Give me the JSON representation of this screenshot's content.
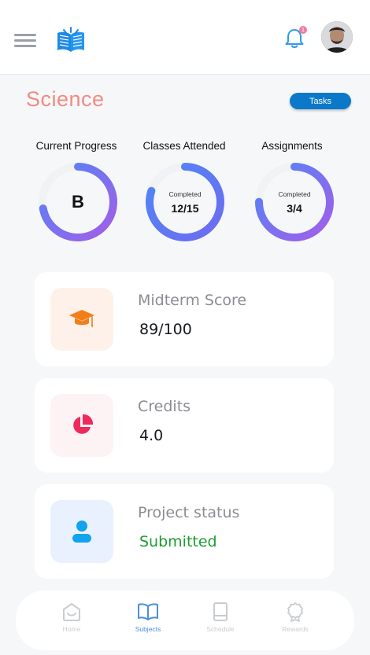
{
  "header": {
    "notification_count": "1",
    "icons": [
      "menu-icon",
      "book-logo-icon",
      "bell-icon",
      "avatar"
    ]
  },
  "subject": {
    "title": "Science",
    "tasks_label": "Tasks"
  },
  "progress": [
    {
      "label": "Current Progress",
      "grade": "B",
      "fraction": 0.72
    },
    {
      "label": "Classes Attended",
      "caption": "Completed",
      "value": "12/15",
      "fraction": 0.8
    },
    {
      "label": "Assignments",
      "caption": "Completed",
      "value": "3/4",
      "fraction": 0.75
    }
  ],
  "cards": [
    {
      "title": "Midterm Score",
      "value": "89/100",
      "icon": "graduation-cap-icon"
    },
    {
      "title": "Credits",
      "value": "4.0",
      "icon": "pie-chart-icon"
    },
    {
      "title": "Project status",
      "value": "Submitted",
      "icon": "user-icon"
    }
  ],
  "nav": [
    {
      "label": "Home",
      "icon": "home-icon"
    },
    {
      "label": "Subjects",
      "icon": "open-book-icon",
      "active": true
    },
    {
      "label": "Schedule",
      "icon": "notebook-icon"
    },
    {
      "label": "Rewards",
      "icon": "award-icon"
    }
  ],
  "colors": {
    "accent_blue": "#0b78c9",
    "title_coral": "#f18b82",
    "ring_gradient_start": "#4f86f7",
    "ring_gradient_end": "#a35ee8",
    "status_green": "#1d9c2e",
    "nav_active": "#4a8fe0"
  }
}
